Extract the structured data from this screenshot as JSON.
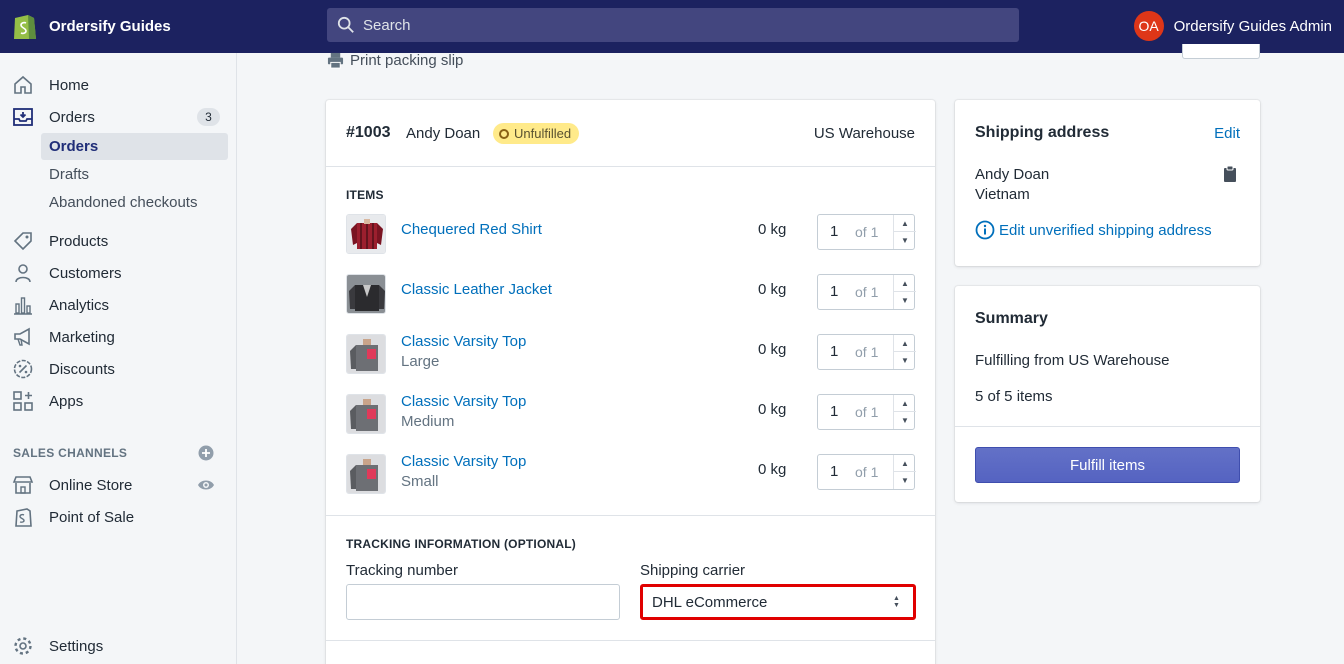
{
  "topbar": {
    "brand_name": "Ordersify Guides",
    "search_placeholder": "Search",
    "user_initials": "OA",
    "user_name": "Ordersify Guides Admin"
  },
  "sidebar": {
    "home": "Home",
    "orders": "Orders",
    "orders_count": "3",
    "orders_sub": [
      "Orders",
      "Drafts",
      "Abandoned checkouts"
    ],
    "products": "Products",
    "customers": "Customers",
    "analytics": "Analytics",
    "marketing": "Marketing",
    "discounts": "Discounts",
    "apps": "Apps",
    "sales_channels_title": "SALES CHANNELS",
    "online_store": "Online Store",
    "point_of_sale": "Point of Sale",
    "settings": "Settings"
  },
  "main": {
    "print_label": "Print packing slip",
    "order_number": "#1003",
    "customer": "Andy Doan",
    "status": "Unfulfilled",
    "location": "US Warehouse",
    "items_title": "ITEMS",
    "items": [
      {
        "name": "Chequered Red Shirt",
        "variant": "",
        "weight": "0 kg",
        "qty": "1",
        "of": "of 1"
      },
      {
        "name": "Classic Leather Jacket",
        "variant": "",
        "weight": "0 kg",
        "qty": "1",
        "of": "of 1"
      },
      {
        "name": "Classic Varsity Top",
        "variant": "Large",
        "weight": "0 kg",
        "qty": "1",
        "of": "of 1"
      },
      {
        "name": "Classic Varsity Top",
        "variant": "Medium",
        "weight": "0 kg",
        "qty": "1",
        "of": "of 1"
      },
      {
        "name": "Classic Varsity Top",
        "variant": "Small",
        "weight": "0 kg",
        "qty": "1",
        "of": "of 1"
      }
    ],
    "tracking_title": "TRACKING INFORMATION (OPTIONAL)",
    "tracking_number_label": "Tracking number",
    "tracking_number_value": "",
    "shipping_carrier_label": "Shipping carrier",
    "shipping_carrier_value": "DHL eCommerce"
  },
  "shipping": {
    "title": "Shipping address",
    "edit": "Edit",
    "name": "Andy Doan",
    "country": "Vietnam",
    "unverified": "Edit unverified shipping address"
  },
  "summary": {
    "title": "Summary",
    "fulfilling_from": "Fulfilling from US Warehouse",
    "items_count": "5 of 5 items",
    "fulfill_button": "Fulfill items"
  },
  "colors": {
    "topbar": "#1c2260",
    "link": "#006fbb",
    "primary": "#5c6ac4",
    "highlight": "#e00000",
    "status_bg": "#ffea8a"
  }
}
